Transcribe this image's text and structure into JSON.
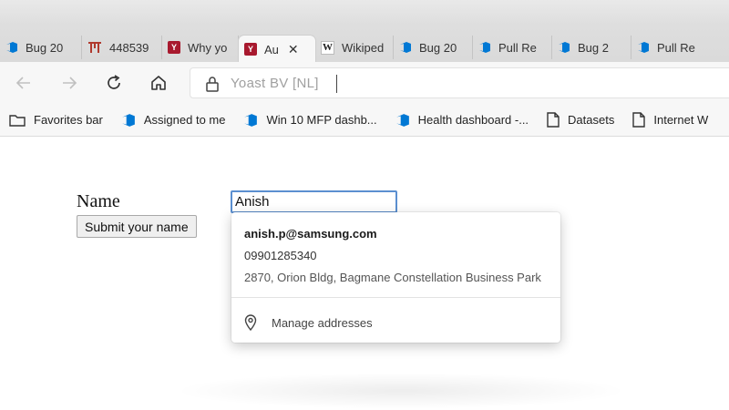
{
  "browser": {
    "tabs": [
      {
        "label": "Bug 20",
        "icon": "azure-devops-icon"
      },
      {
        "label": "448539",
        "icon": "gate-icon"
      },
      {
        "label": "Why yo",
        "icon": "red-y-icon"
      },
      {
        "label": "Au",
        "icon": "red-y-icon",
        "active": true,
        "close": "✕"
      },
      {
        "label": "Wikiped",
        "icon": "wikipedia-icon"
      },
      {
        "label": "Bug 20",
        "icon": "azure-devops-icon"
      },
      {
        "label": "Pull Re",
        "icon": "azure-devops-icon"
      },
      {
        "label": "Bug 2",
        "icon": "azure-devops-icon"
      },
      {
        "label": "Pull Re",
        "icon": "azure-devops-icon"
      }
    ],
    "address_bar": {
      "text": "Yoast BV [NL]"
    },
    "favorites": [
      {
        "label": "Favorites bar",
        "icon": "folder-icon"
      },
      {
        "label": "Assigned to me",
        "icon": "azure-devops-icon"
      },
      {
        "label": "Win 10 MFP dashb...",
        "icon": "azure-devops-icon"
      },
      {
        "label": "Health dashboard -...",
        "icon": "azure-devops-icon"
      },
      {
        "label": "Datasets",
        "icon": "document-icon"
      },
      {
        "label": "Internet W",
        "icon": "document-icon"
      }
    ]
  },
  "form": {
    "name_label": "Name",
    "name_value": "Anish",
    "submit_label": "Submit your name"
  },
  "autofill": {
    "email": "anish.p@samsung.com",
    "phone": "09901285340",
    "address": "2870, Orion Bldg, Bagmane Constellation Business Park",
    "manage_label": "Manage addresses"
  },
  "colors": {
    "ado_blue": "#0078d4",
    "tab_red": "#a8192e",
    "focus_border": "#5b8fd0"
  }
}
